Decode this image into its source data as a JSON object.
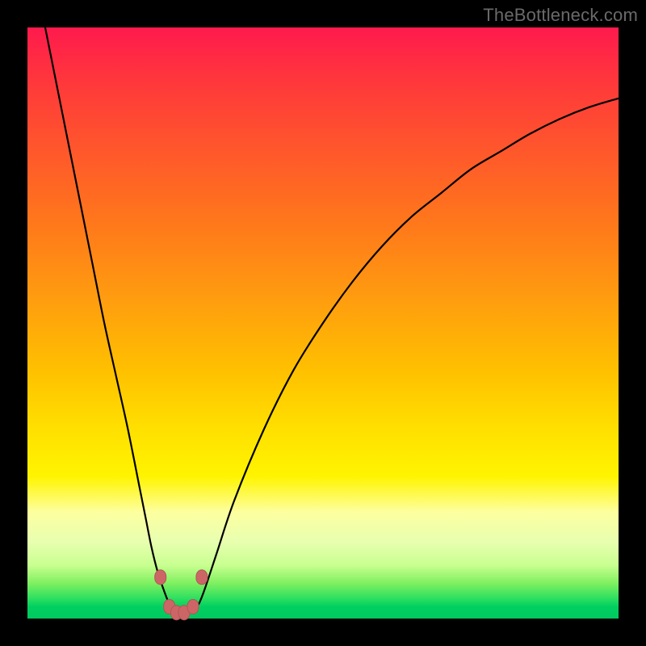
{
  "watermark": "TheBottleneck.com",
  "colors": {
    "frame_bg": "#000000",
    "gradient_top": "#ff1a4d",
    "gradient_bottom": "#00c860",
    "curve_stroke": "#000000",
    "marker_fill": "#cc6666",
    "marker_stroke": "#b35555",
    "watermark_text": "#6a6a6a"
  },
  "chart_data": {
    "type": "line",
    "title": "",
    "xlabel": "",
    "ylabel": "",
    "xlim": [
      0,
      100
    ],
    "ylim": [
      0,
      100
    ],
    "grid": false,
    "legend": false,
    "series": [
      {
        "name": "bottleneck-curve",
        "x": [
          3,
          5,
          7,
          9,
          11,
          13,
          15,
          17,
          19,
          20,
          21,
          22,
          23,
          24,
          25,
          26,
          27,
          28,
          29,
          30,
          32,
          35,
          40,
          45,
          50,
          55,
          60,
          65,
          70,
          75,
          80,
          85,
          90,
          95,
          100
        ],
        "values": [
          100,
          90,
          80,
          70,
          60,
          50,
          41,
          32,
          22,
          17,
          12,
          8,
          5,
          2.5,
          1.3,
          1.0,
          1.0,
          1.3,
          2.5,
          5,
          11,
          20,
          32,
          42,
          50,
          57,
          63,
          68,
          72,
          76,
          79,
          82,
          84.5,
          86.5,
          88
        ]
      }
    ],
    "annotations": {
      "trough_markers_x": [
        22.5,
        24.0,
        25.2,
        26.5,
        28.0,
        29.5
      ],
      "trough_markers_y": [
        7.0,
        2.0,
        1.0,
        1.0,
        2.0,
        7.0
      ]
    }
  }
}
